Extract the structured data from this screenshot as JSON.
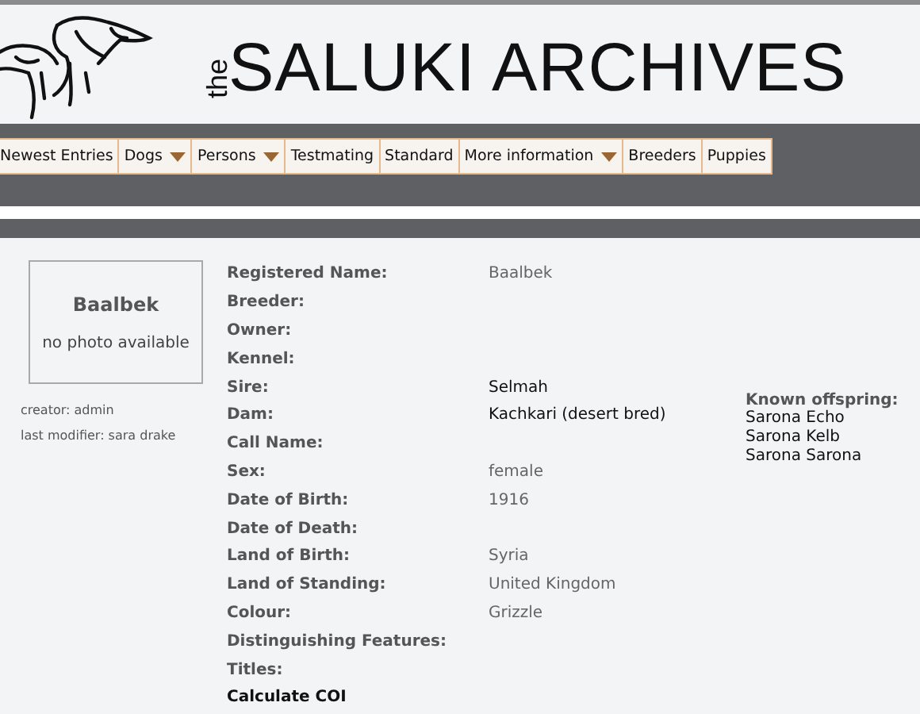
{
  "header": {
    "logo_prefix": "the",
    "logo_text": "SALUKI ARCHIVES"
  },
  "nav": [
    {
      "label": "Newest Entries",
      "dropdown": false
    },
    {
      "label": "Dogs",
      "dropdown": true
    },
    {
      "label": "Persons",
      "dropdown": true
    },
    {
      "label": "Testmating",
      "dropdown": false
    },
    {
      "label": "Standard",
      "dropdown": false
    },
    {
      "label": "More information",
      "dropdown": true
    },
    {
      "label": "Breeders",
      "dropdown": false
    },
    {
      "label": "Puppies",
      "dropdown": false
    }
  ],
  "photo_box": {
    "name": "Baalbek",
    "caption": "no photo available"
  },
  "meta": [
    "creator: admin",
    "last modifier: sara drake"
  ],
  "fields": [
    {
      "label": "Registered Name:",
      "value": "Baalbek",
      "kind": "text"
    },
    {
      "label": "Breeder:"
    },
    {
      "label": "Owner:"
    },
    {
      "label": "Kennel:"
    },
    {
      "label": "Sire:",
      "value": "Selmah",
      "kind": "link"
    },
    {
      "label": "Dam:",
      "value": "Kachkari (desert bred)",
      "kind": "link"
    },
    {
      "label": "Call Name:"
    },
    {
      "label": "Sex:",
      "value": "female",
      "kind": "text"
    },
    {
      "label": "Date of Birth:",
      "value": "1916",
      "kind": "text"
    },
    {
      "label": "Date of Death:"
    },
    {
      "label": "Land of Birth:",
      "value": "Syria",
      "kind": "text"
    },
    {
      "label": "Land of Standing:",
      "value": "United Kingdom",
      "kind": "text"
    },
    {
      "label": "Colour:",
      "value": "Grizzle",
      "kind": "text"
    },
    {
      "label": "Distinguishing Features:"
    },
    {
      "label": "Titles:"
    }
  ],
  "calculate_link": "Calculate COI",
  "offspring": {
    "heading": "Known offspring:",
    "items": [
      "Sarona Echo",
      "Sarona Kelb",
      "Sarona Sarona"
    ]
  }
}
